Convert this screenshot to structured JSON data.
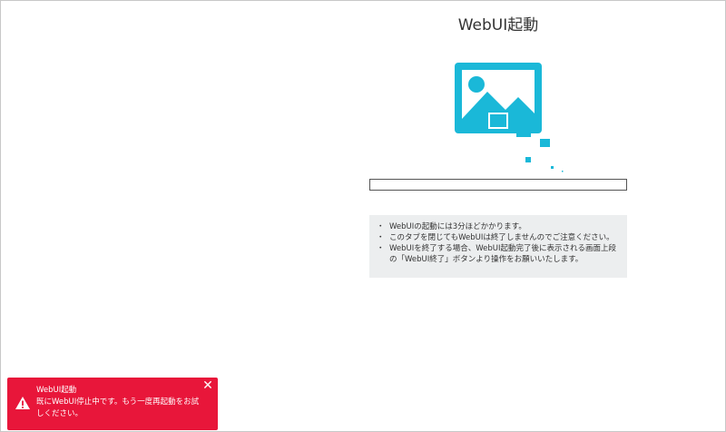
{
  "page": {
    "title": "WebUI起動"
  },
  "progress": {
    "fraction": 0
  },
  "notes": [
    "WebUIの起動には3分ほどかかります。",
    "このタブを閉じてもWebUIは終了しませんのでご注意ください。",
    "WebUIを終了する場合、WebUI起動完了後に表示される画面上段の「WebUI終了」ボタンより操作をお願いいたします。"
  ],
  "toast": {
    "title": "WebUI起動",
    "message": "既にWebUI停止中です。もう一度再起動をお試しください。",
    "close_icon": "close-icon",
    "warning_icon": "warning-icon",
    "color": "#e8163a"
  },
  "illustration": {
    "icon": "image-icon",
    "color": "#1ab8d8"
  }
}
